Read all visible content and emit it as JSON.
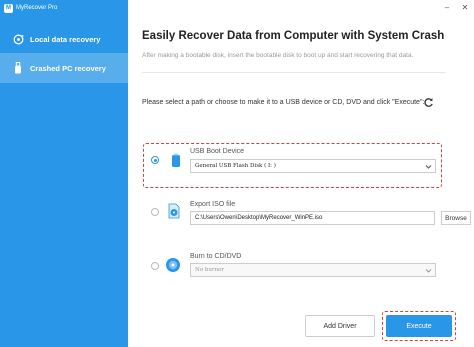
{
  "app": {
    "title": "MyRecover Pro",
    "logo_letter": "M"
  },
  "sidebar": {
    "items": [
      {
        "label": "Local data recovery",
        "icon": "refresh-disk-icon",
        "active": false
      },
      {
        "label": "Crashed PC recovery",
        "icon": "usb-icon",
        "active": true
      }
    ]
  },
  "window_controls": {
    "minimize": "–",
    "close": "✕"
  },
  "main": {
    "title": "Easily Recover Data from Computer with System Crash",
    "subtitle": "After making a bootable disk, insert the bootable disk to boot up and start recovering that data.",
    "instruction": "Please select a path or choose to make it to a USB device or CD, DVD and click \"Execute\":"
  },
  "options": {
    "usb": {
      "label": "USB Boot Device",
      "value": "General USB Flash Disk ( I: )",
      "selected": true
    },
    "iso": {
      "label": "Export ISO file",
      "value": "C:\\Users\\Owen\\Desktop\\MyRecover_WinPE.iso",
      "button": "Browse",
      "selected": false
    },
    "cd": {
      "label": "Burn to CD/DVD",
      "value": "No burner",
      "selected": false
    }
  },
  "buttons": {
    "add_driver": "Add Driver",
    "execute": "Execute"
  },
  "colors": {
    "accent": "#2a96e8",
    "highlight": "#e03b3b"
  }
}
